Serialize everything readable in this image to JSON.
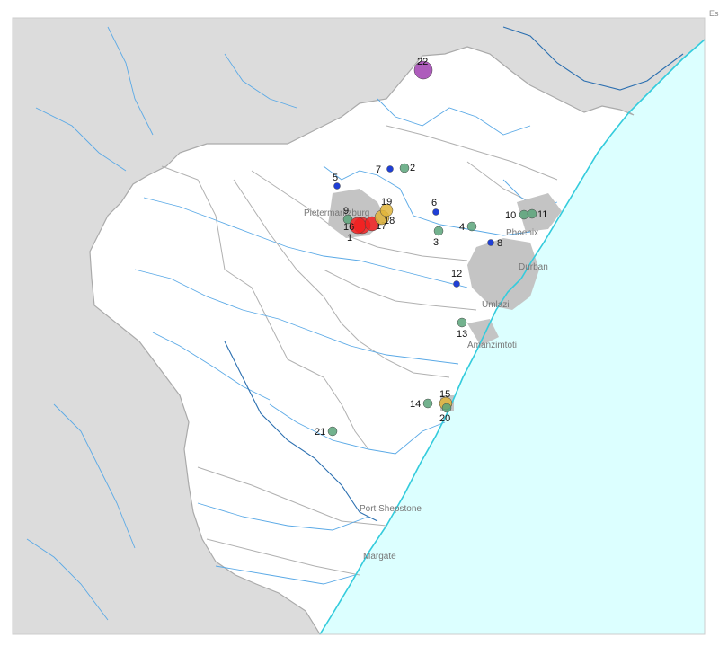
{
  "map": {
    "corner_text": "Es",
    "colors": {
      "land_outside": "#dcdcdc",
      "region": "#ffffff",
      "ocean": "#dcffff",
      "coast": "#33ccdd",
      "river": "#5aa9e6",
      "river_major": "#2b6fb0",
      "urban": "#c4c4c4",
      "boundary": "#b0b0b0",
      "marker_green": "#5aa57a",
      "marker_blue": "#1f3fd6",
      "marker_red": "#f22020",
      "marker_yellow": "#e0b43a",
      "marker_purple": "#a040b0"
    },
    "towns": [
      {
        "name": "Pietermaritzburg"
      },
      {
        "name": "Phoenix"
      },
      {
        "name": "Durban"
      },
      {
        "name": "Umlazi"
      },
      {
        "name": "Amanzimtoti"
      },
      {
        "name": "Port Shepstone"
      },
      {
        "name": "Margate"
      }
    ],
    "markers": [
      {
        "label": "1",
        "kind": "red"
      },
      {
        "label": "2",
        "kind": "green"
      },
      {
        "label": "3",
        "kind": "green"
      },
      {
        "label": "4",
        "kind": "green"
      },
      {
        "label": "5",
        "kind": "blue"
      },
      {
        "label": "6",
        "kind": "blue"
      },
      {
        "label": "7",
        "kind": "blue"
      },
      {
        "label": "8",
        "kind": "blue"
      },
      {
        "label": "9",
        "kind": "green"
      },
      {
        "label": "10",
        "kind": "green"
      },
      {
        "label": "11",
        "kind": "green"
      },
      {
        "label": "12",
        "kind": "blue"
      },
      {
        "label": "13",
        "kind": "green"
      },
      {
        "label": "14",
        "kind": "green"
      },
      {
        "label": "15",
        "kind": "yellow"
      },
      {
        "label": "16",
        "kind": "red"
      },
      {
        "label": "17",
        "kind": "red"
      },
      {
        "label": "18",
        "kind": "yellow"
      },
      {
        "label": "19",
        "kind": "yellow"
      },
      {
        "label": "20",
        "kind": "green"
      },
      {
        "label": "21",
        "kind": "green"
      },
      {
        "label": "22",
        "kind": "purple"
      }
    ]
  }
}
